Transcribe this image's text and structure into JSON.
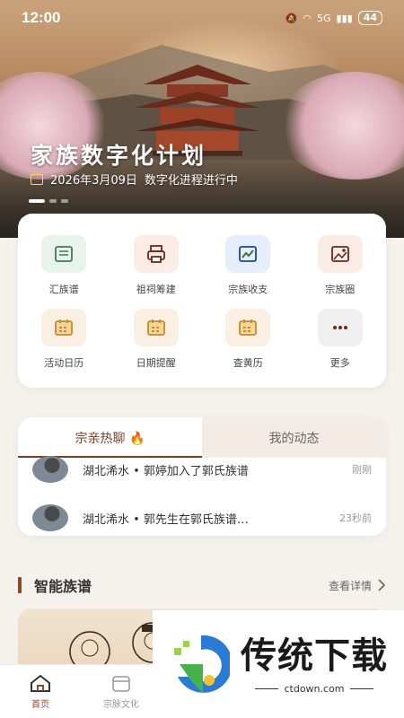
{
  "status_bar": {
    "time": "12:00",
    "network": "5G",
    "battery": "44"
  },
  "banner": {
    "title": "家族数字化计划",
    "date": "2026年3月09日",
    "subtitle": "数字化进程进行中",
    "slides_total": 3,
    "slide_active": 1
  },
  "features": [
    {
      "label": "汇族谱",
      "icon": "book-icon",
      "bg": "#e8f3ec",
      "color": "#3f7a59"
    },
    {
      "label": "祖祠筹建",
      "icon": "printer-icon",
      "bg": "#fbece6",
      "color": "#6a2a17"
    },
    {
      "label": "宗族收支",
      "icon": "chart-icon",
      "bg": "#e7eefb",
      "color": "#2f7a3c"
    },
    {
      "label": "宗族圈",
      "icon": "image-icon",
      "bg": "#fbece6",
      "color": "#6a2a17"
    },
    {
      "label": "活动日历",
      "icon": "calendar-icon",
      "bg": "#fbeee2",
      "color": "#c78a2c"
    },
    {
      "label": "日期提醒",
      "icon": "calendar-icon",
      "bg": "#fbeee2",
      "color": "#c78a2c"
    },
    {
      "label": "查黄历",
      "icon": "calendar-icon",
      "bg": "#fbeee2",
      "color": "#c78a2c"
    },
    {
      "label": "更多",
      "icon": "more-icon",
      "bg": "#f0f0f0",
      "color": "#6a2a17"
    }
  ],
  "tabs": {
    "active": "宗亲热聊 🔥",
    "inactive": "我的动态"
  },
  "feed": [
    {
      "text": "湖北浠水 • 郭婷加入了郭氏族谱",
      "time": "刚刚"
    },
    {
      "text": "湖北浠水 • 郭先生在郭氏族谱…",
      "time": "23秒前"
    }
  ],
  "section": {
    "title": "智能族谱",
    "more": "查看详情"
  },
  "bottom_nav": [
    {
      "label": "首页",
      "icon": "home-icon",
      "active": true
    },
    {
      "label": "宗脉文化",
      "icon": "culture-icon",
      "active": false
    }
  ],
  "watermark": {
    "title": "传统下载",
    "url": "ctdown.com"
  },
  "colors": {
    "accent": "#8c4a2b",
    "tab_inactive_bg": "#f4ece4"
  }
}
